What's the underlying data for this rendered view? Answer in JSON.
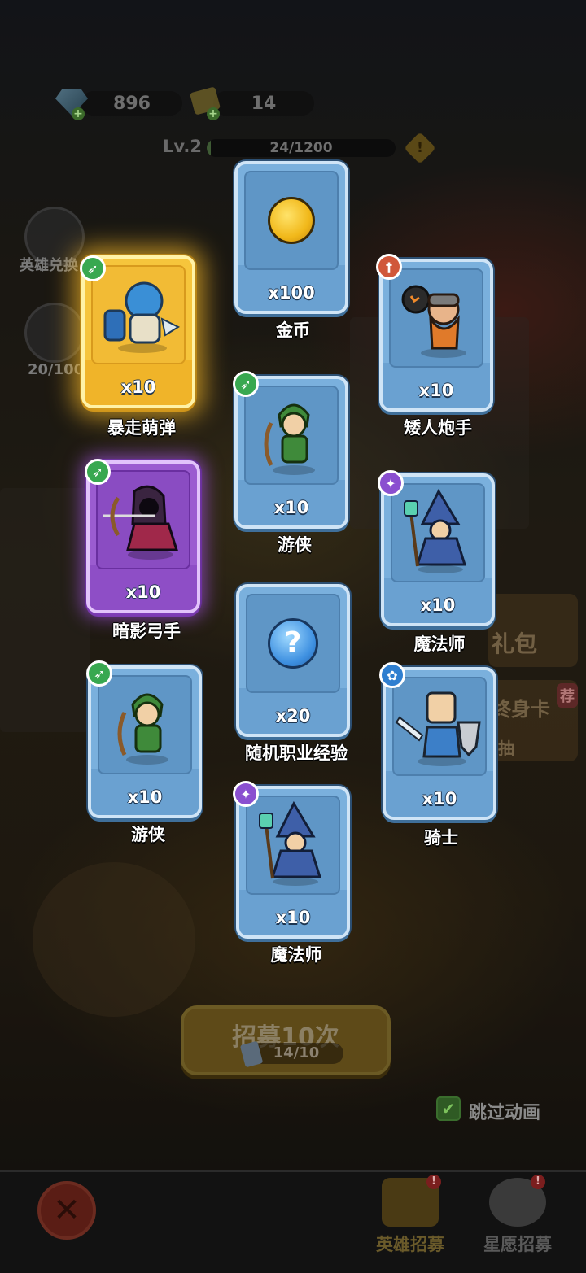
{
  "currency": {
    "gems": "896",
    "tickets": "14"
  },
  "player": {
    "level_label": "Lv.2",
    "exp_text": "24/1200",
    "exp_progress": 0.02
  },
  "side_menu": [
    {
      "label": "英雄兑换"
    },
    {
      "label": "20/100"
    }
  ],
  "right_widgets": {
    "gift_label": "礼包",
    "lifetime_card_label": "终身卡",
    "recommend_badge": "荐",
    "draw_label": "抽"
  },
  "rewards": [
    {
      "name": "暴走萌弹",
      "qty": "x10",
      "rarity": "legendary",
      "class_icon": "ranger-bow-icon",
      "sprite": "hero-blue-helmet"
    },
    {
      "name": "金币",
      "qty": "x100",
      "rarity": "common",
      "class_icon": "",
      "sprite": "gold-coin"
    },
    {
      "name": "矮人炮手",
      "qty": "x10",
      "rarity": "common",
      "class_icon": "warrior-sword-icon",
      "sprite": "dwarf-bomber"
    },
    {
      "name": "游侠",
      "qty": "x10",
      "rarity": "common",
      "class_icon": "ranger-bow-icon",
      "sprite": "green-ranger"
    },
    {
      "name": "暗影弓手",
      "qty": "x10",
      "rarity": "epic",
      "class_icon": "ranger-bow-icon",
      "sprite": "shadow-archer"
    },
    {
      "name": "魔法师",
      "qty": "x10",
      "rarity": "common",
      "class_icon": "mage-staff-icon",
      "sprite": "wizard"
    },
    {
      "name": "随机职业经验",
      "qty": "x20",
      "rarity": "common",
      "class_icon": "",
      "sprite": "question-orb"
    },
    {
      "name": "游侠",
      "qty": "x10",
      "rarity": "common",
      "class_icon": "ranger-bow-icon",
      "sprite": "green-ranger"
    },
    {
      "name": "骑士",
      "qty": "x10",
      "rarity": "common",
      "class_icon": "tank-paw-icon",
      "sprite": "knight"
    },
    {
      "name": "魔法师",
      "qty": "x10",
      "rarity": "common",
      "class_icon": "mage-staff-icon",
      "sprite": "wizard"
    }
  ],
  "recruit": {
    "button_label": "招募10次",
    "ticket_count": "14/10"
  },
  "skip_animation": {
    "label": "跳过动画",
    "checked": true
  },
  "bottom_tabs": [
    {
      "label": "英雄招募",
      "badge": "!"
    },
    {
      "label": "星愿招募",
      "badge": "!"
    }
  ],
  "colors": {
    "card_common": "#7ab0dd",
    "card_legendary": "#f6c53c",
    "card_epic": "#9b5cd0",
    "class_ranger": "#38a850",
    "class_mage": "#8a4fd0",
    "class_warrior": "#d0573a",
    "class_tank": "#2f7fd0"
  }
}
